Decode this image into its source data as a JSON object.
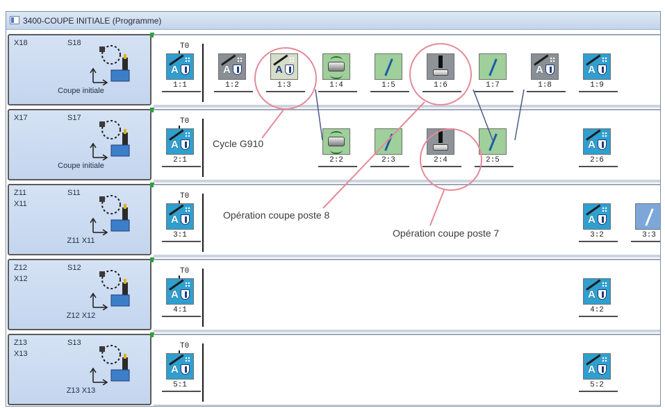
{
  "window": {
    "title": "3400-COUPE INITIALE (Programme)"
  },
  "channels": [
    {
      "id": "row-1",
      "axis1": "X18",
      "axis2": "",
      "spindle": "S18",
      "name": "Coupe initiale",
      "tool_label": "T0",
      "ops": [
        {
          "label": "1:1",
          "icon": "tool-a-shield-icon",
          "style": "tool"
        },
        {
          "label": "1:2",
          "icon": "tool-a-shield-icon",
          "style": "toolgray"
        },
        {
          "label": "1:3",
          "icon": "tool-a-shield-icon",
          "style": "toolpale"
        },
        {
          "label": "1:4",
          "icon": "rotating-cylinder-icon",
          "style": "cylinder"
        },
        {
          "label": "1:5",
          "icon": "linear-move-icon",
          "style": "green"
        },
        {
          "label": "1:6",
          "icon": "cut-off-icon",
          "style": "cut"
        },
        {
          "label": "1:7",
          "icon": "linear-move-icon",
          "style": "green"
        },
        {
          "label": "1:8",
          "icon": "tool-a-shield-icon",
          "style": "toolgray"
        },
        {
          "label": "1:9",
          "icon": "tool-a-shield-icon",
          "style": "tool"
        }
      ]
    },
    {
      "id": "row-2",
      "axis1": "X17",
      "axis2": "",
      "spindle": "S17",
      "name": "Coupe initiale",
      "tool_label": "T0",
      "ops": [
        {
          "label": "2:1",
          "icon": "tool-a-shield-icon",
          "style": "tool"
        },
        {
          "label": "2:2",
          "icon": "rotating-cylinder-icon",
          "style": "cylinder"
        },
        {
          "label": "2:3",
          "icon": "linear-move-icon",
          "style": "green"
        },
        {
          "label": "2:4",
          "icon": "cut-off-icon",
          "style": "cut"
        },
        {
          "label": "2:5",
          "icon": "linear-move-icon",
          "style": "green"
        },
        {
          "label": "2:6",
          "icon": "tool-a-shield-icon",
          "style": "tool"
        }
      ]
    },
    {
      "id": "row-3",
      "axis1": "Z11",
      "axis2": "X11",
      "spindle": "S11",
      "name": "Z11 X11",
      "tool_label": "T0",
      "ops": [
        {
          "label": "3:1",
          "icon": "tool-a-shield-icon",
          "style": "tool"
        },
        {
          "label": "3:2",
          "icon": "tool-a-shield-icon",
          "style": "tool"
        },
        {
          "label": "3:3",
          "icon": "linear-move-icon",
          "style": "blue"
        }
      ]
    },
    {
      "id": "row-4",
      "axis1": "Z12",
      "axis2": "X12",
      "spindle": "S12",
      "name": "Z12 X12",
      "tool_label": "T0",
      "ops": [
        {
          "label": "4:1",
          "icon": "tool-a-shield-icon",
          "style": "tool"
        },
        {
          "label": "4:2",
          "icon": "tool-a-shield-icon",
          "style": "tool"
        }
      ]
    },
    {
      "id": "row-5",
      "axis1": "Z13",
      "axis2": "X13",
      "spindle": "S13",
      "name": "Z13 X13",
      "tool_label": "T0",
      "ops": [
        {
          "label": "5:1",
          "icon": "tool-a-shield-icon",
          "style": "tool"
        },
        {
          "label": "5:2",
          "icon": "tool-a-shield-icon",
          "style": "tool"
        }
      ]
    }
  ],
  "annotations": {
    "cycle": "Cycle G910",
    "op_poste_8": "Opération coupe poste 8",
    "op_poste_7": "Opération coupe poste 7"
  },
  "colors": {
    "highlight_circle": "#e58a98",
    "panel_bg": "#c9d9f0",
    "op_tool": "#2f9fcf",
    "op_green": "#9fcf9a",
    "op_cut": "#8d9398"
  }
}
